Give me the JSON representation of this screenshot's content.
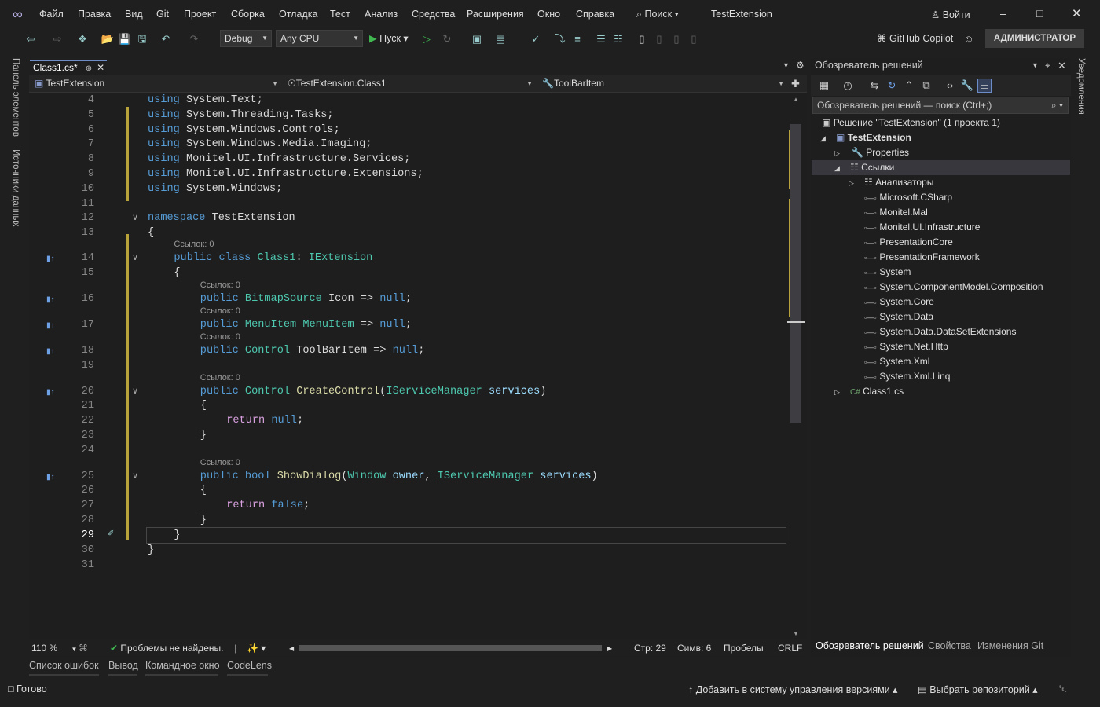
{
  "menu": {
    "items": [
      "Файл",
      "Правка",
      "Вид",
      "Git",
      "Проект",
      "Сборка",
      "Отладка",
      "Тест",
      "Анализ",
      "Средства",
      "Расширения",
      "Окно",
      "Справка"
    ],
    "search": "Поиск",
    "solution_name": "TestExtension",
    "signin": "Войти"
  },
  "toolbar": {
    "config": "Debug",
    "platform": "Any CPU",
    "run_label": "Пуск",
    "copilot": "GitHub Copilot",
    "admin": "АДМИНИСТРАТОР"
  },
  "left_strip": {
    "toolbox": "Панель элементов",
    "datasources": "Источники данных"
  },
  "right_strip": {
    "notifications": "Уведомления"
  },
  "editor": {
    "tab_label": "Class1.cs*",
    "nav_project": "TestExtension",
    "nav_class": "TestExtension.Class1",
    "nav_member": "ToolBarItem",
    "lens_label": "Ссылок: 0",
    "lines": [
      {
        "n": "4",
        "text": "using System.Text;"
      },
      {
        "n": "5",
        "text": "using System.Threading.Tasks;"
      },
      {
        "n": "6",
        "text": "using System.Windows.Controls;"
      },
      {
        "n": "7",
        "text": "using System.Windows.Media.Imaging;"
      },
      {
        "n": "8",
        "text": "using Monitel.UI.Infrastructure.Services;"
      },
      {
        "n": "9",
        "text": "using Monitel.UI.Infrastructure.Extensions;"
      },
      {
        "n": "10",
        "text": "using System.Windows;"
      },
      {
        "n": "11",
        "text": ""
      },
      {
        "n": "12",
        "text": "namespace TestExtension"
      },
      {
        "n": "13",
        "text": "{"
      },
      {
        "n": "14",
        "text": "public class Class1: IExtension"
      },
      {
        "n": "15",
        "text": "{"
      },
      {
        "n": "16",
        "text": "public BitmapSource Icon => null;"
      },
      {
        "n": "17",
        "text": "public MenuItem MenuItem => null;"
      },
      {
        "n": "18",
        "text": "public Control ToolBarItem => null;"
      },
      {
        "n": "19",
        "text": ""
      },
      {
        "n": "20",
        "text": "public Control CreateControl(IServiceManager services)"
      },
      {
        "n": "21",
        "text": "{"
      },
      {
        "n": "22",
        "text": "return null;"
      },
      {
        "n": "23",
        "text": "}"
      },
      {
        "n": "24",
        "text": ""
      },
      {
        "n": "25",
        "text": "public bool ShowDialog(Window owner, IServiceManager services)"
      },
      {
        "n": "26",
        "text": "{"
      },
      {
        "n": "27",
        "text": "return false;"
      },
      {
        "n": "28",
        "text": "}"
      },
      {
        "n": "29",
        "text": "}"
      },
      {
        "n": "30",
        "text": "}"
      },
      {
        "n": "31",
        "text": ""
      }
    ],
    "zoom": "110 %",
    "issues": "Проблемы не найдены.",
    "line_pos": "Стр: 29",
    "char_pos": "Симв: 6",
    "indent": "Пробелы",
    "eol": "CRLF"
  },
  "solution_explorer": {
    "title": "Обозреватель решений",
    "search_placeholder": "Обозреватель решений — поиск (Ctrl+;)",
    "solution": "Решение \"TestExtension\" (1 проекта 1)",
    "project": "TestExtension",
    "properties": "Properties",
    "references": "Ссылки",
    "analyzers": "Анализаторы",
    "refs": [
      "Microsoft.CSharp",
      "Monitel.Mal",
      "Monitel.UI.Infrastructure",
      "PresentationCore",
      "PresentationFramework",
      "System",
      "System.ComponentModel.Composition",
      "System.Core",
      "System.Data",
      "System.Data.DataSetExtensions",
      "System.Net.Http",
      "System.Xml",
      "System.Xml.Linq"
    ],
    "file": "Class1.cs",
    "bottom_tabs": [
      "Обозреватель решений",
      "Свойства",
      "Изменения Git"
    ]
  },
  "output_tabs": [
    "Список ошибок",
    "Вывод",
    "Командное окно",
    "CodeLens"
  ],
  "status": {
    "ready": "Готово",
    "add_vcs": "Добавить в систему управления версиями",
    "select_repo": "Выбрать репозиторий"
  }
}
